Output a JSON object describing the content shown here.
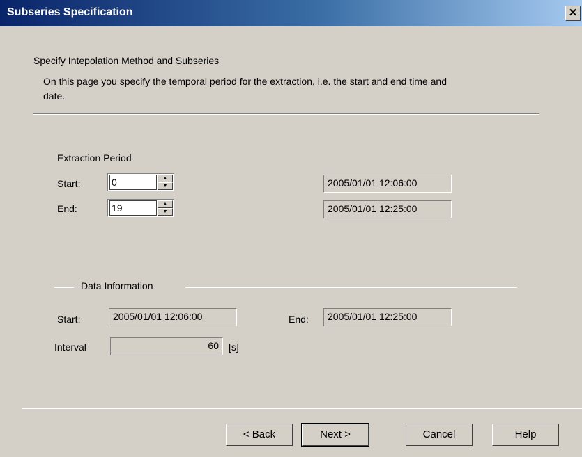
{
  "window": {
    "title": "Subseries Specification",
    "close_glyph": "✕"
  },
  "header": {
    "heading": "Specify Intepolation Method and Subseries",
    "description_line1": "On this page you specify the temporal period for the extraction, i.e. the start and end time and",
    "description_line2": "date."
  },
  "extraction": {
    "group_label": "Extraction Period",
    "start_label": "Start:",
    "start_value": "0",
    "start_datetime": "2005/01/01 12:06:00",
    "end_label": "End:",
    "end_value": "19",
    "end_datetime": "2005/01/01 12:25:00"
  },
  "data_info": {
    "group_label": "Data Information",
    "start_label": "Start:",
    "start_value": "2005/01/01 12:06:00",
    "end_label": "End:",
    "end_value": "2005/01/01 12:25:00",
    "interval_label": "Interval",
    "interval_value": "60",
    "interval_unit": "[s]"
  },
  "buttons": {
    "back": "< Back",
    "next": "Next >",
    "cancel": "Cancel",
    "help": "Help"
  },
  "icons": {
    "spin_up": "▲",
    "spin_down": "▼"
  }
}
